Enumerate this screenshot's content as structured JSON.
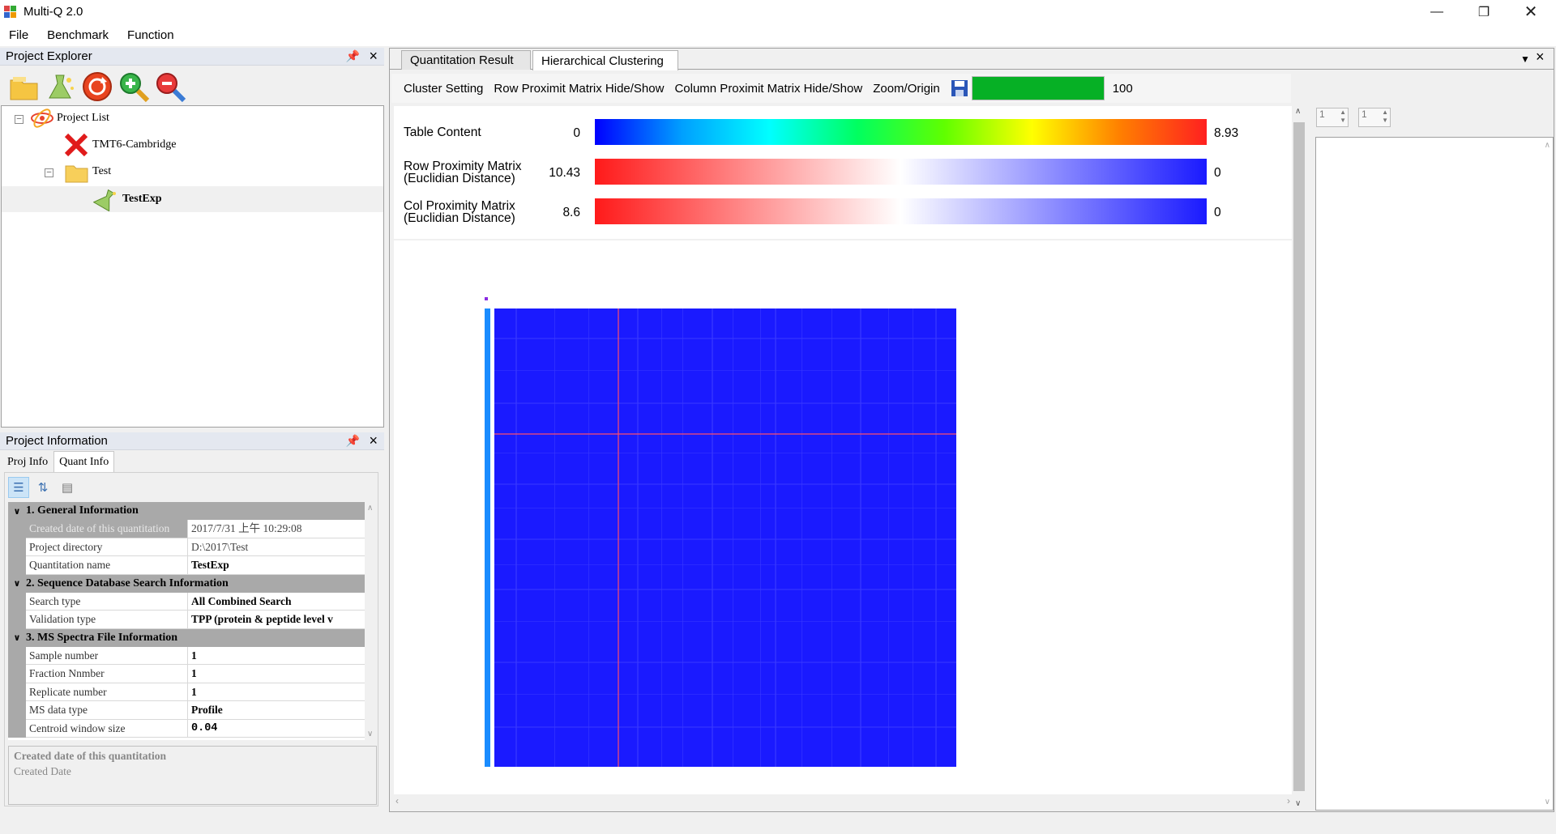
{
  "window": {
    "title": "Multi-Q 2.0"
  },
  "menu": [
    "File",
    "Benchmark",
    "Function"
  ],
  "explorer": {
    "title": "Project Explorer",
    "tree": {
      "root": "Project List",
      "item1": "TMT6-Cambridge",
      "item2": "Test",
      "item3": "TestExp"
    }
  },
  "info": {
    "title": "Project Information",
    "tabs": [
      "Proj Info",
      "Quant Info"
    ],
    "categories": [
      "1. General Information",
      "2. Sequence Database Search Information",
      "3. MS Spectra File Information"
    ],
    "rows": [
      {
        "name": "Created date of this quantitation",
        "value": "2017/7/31 上午 10:29:08"
      },
      {
        "name": "Project directory",
        "value": "D:\\2017\\Test"
      },
      {
        "name": "Quantitation name",
        "value": "TestExp"
      },
      {
        "name": "Search type",
        "value": "All Combined Search"
      },
      {
        "name": "Validation type",
        "value": "TPP (protein & peptide level v"
      },
      {
        "name": "Sample number",
        "value": "1"
      },
      {
        "name": "Fraction Nnmber",
        "value": "1"
      },
      {
        "name": "Replicate number",
        "value": "1"
      },
      {
        "name": "MS data type",
        "value": "Profile"
      },
      {
        "name": "Centroid window size",
        "value": "0.04"
      }
    ],
    "desc_title": "Created date of this quantitation",
    "desc_text": "Created Date"
  },
  "doc_tabs": [
    "Quantitation Result",
    "Hierarchical Clustering"
  ],
  "cluster_toolbar": {
    "cluster_setting": "Cluster Setting",
    "row_toggle": "Row Proximit Matrix Hide/Show",
    "col_toggle": "Column Proximit Matrix Hide/Show",
    "zoom": "Zoom/Origin",
    "zoom_value": "100",
    "zoom_fraction": 1.0
  },
  "legend": [
    {
      "label": "Table Content",
      "label2": "",
      "min": "0",
      "max": "8.93"
    },
    {
      "label": "Row Proximity Matrix",
      "label2": "(Euclidian Distance)",
      "min": "10.43",
      "max": "0"
    },
    {
      "label": "Col Proximity Matrix",
      "label2": "(Euclidian Distance)",
      "min": "8.6",
      "max": "0"
    }
  ],
  "side_spinners": [
    "1",
    "1"
  ],
  "colors": {
    "heatmap_fill": "#1a1aff",
    "dendro_bar": "#1a8cff",
    "selection_line": "#ff4d6a",
    "zoom_fill": "#06b025"
  }
}
